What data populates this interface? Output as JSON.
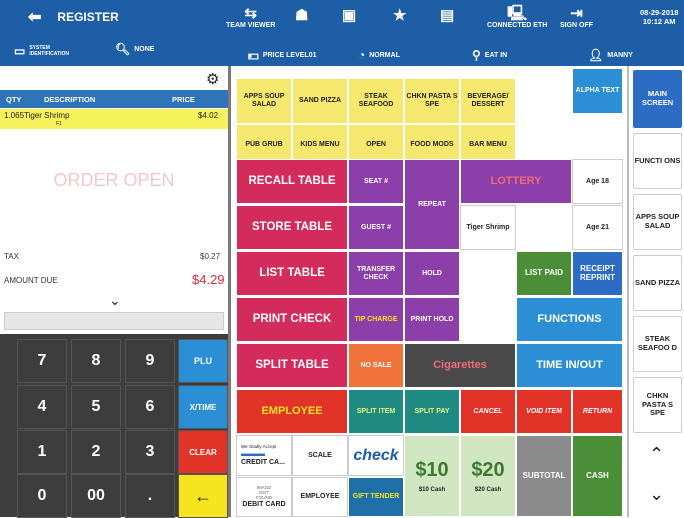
{
  "topbar": {
    "back_icon": "arrow-left-icon",
    "register": "REGISTER",
    "system_id": "SYSTEM IDENTIFICATION",
    "search": "NONE",
    "team_viewer": "TEAM VIEWER",
    "price_level": "PRICE LEVEL01",
    "mode": "NORMAL",
    "connected": "CONNECTED ETH",
    "eat_in": "EAT IN",
    "sign_off": "SIGN OFF",
    "user": "MANNY",
    "date": "08-29-2018",
    "time": "10:12 AM"
  },
  "order": {
    "gear_icon": "gear-icon",
    "headers": {
      "qty": "QTY",
      "desc": "DESCRIPTION",
      "price": "PRICE"
    },
    "items": [
      {
        "qty": "1.065",
        "desc": "Tiger Shrimp",
        "price": "$4.02",
        "sub": "F1"
      }
    ],
    "status": "ORDER OPEN",
    "tax_label": "TAX",
    "tax": "$0.27",
    "due_label": "AMOUNT DUE",
    "due": "$4.29"
  },
  "keypad": {
    "keys": [
      "7",
      "8",
      "9",
      "4",
      "5",
      "6",
      "1",
      "2",
      "3",
      "0",
      "00",
      "."
    ],
    "plu": "PLU",
    "xtime": "X/TIME",
    "clear": "CLEAR",
    "enter": "←"
  },
  "grid": {
    "apps": "APPS SOUP SALAD",
    "sand": "SAND PIZZA",
    "steak": "STEAK SEAFOOD",
    "chkn": "CHKN PASTA S SPE",
    "bev": "BEVERAGE/ DESSERT",
    "alpha": "ALPHA TEXT",
    "pub": "PUB GRUB",
    "kids": "KIDS MENU",
    "open": "OPEN",
    "food": "FOOD MODS",
    "bar": "BAR MENU",
    "recall": "RECALL TABLE",
    "seat": "SEAT #",
    "repeat": "REPEAT",
    "lottery": "LOTTERY",
    "age18": "Age 18",
    "store": "STORE TABLE",
    "guest": "GUEST #",
    "tiger": "Tiger Shrimp",
    "age21": "Age 21",
    "list": "LIST TABLE",
    "transfer": "TRANSFER CHECK",
    "hold": "HOLD",
    "listpaid": "LIST PAID",
    "receipt": "RECEIPT REPRINT",
    "print": "PRINT CHECK",
    "tip": "TIP CHARGE",
    "printhold": "PRINT HOLD",
    "functions": "FUNCTIONS",
    "split": "SPLIT TABLE",
    "nosale": "NO SALE",
    "cig": "Cigarettes",
    "timeio": "TIME IN/OUT",
    "employee": "EMPLOYEE",
    "splititem": "SPLIT ITEM",
    "splitpay": "SPLIT PAY",
    "cancel": "CANCEL",
    "void": "VOID ITEM",
    "return": "RETURN",
    "credit": "CREDIT CA...",
    "credit_note": "We Gladly Accept",
    "scale": "SCALE",
    "check": "check",
    "ten": "$10",
    "ten_cap": "$10 Cash",
    "twenty": "$20",
    "twenty_cap": "$20 Cash",
    "subtotal": "SUBTOTAL",
    "cash": "CASH",
    "debit": "DEBIT CARD",
    "debit_note": "IMAGE NOT FOUND",
    "employee2": "EMPLOYEE",
    "gift": "GIFT TENDER"
  },
  "side": {
    "main": "MAIN SCREEN",
    "func": "FUNCTI ONS",
    "apps": "APPS SOUP SALAD",
    "sand": "SAND PIZZA",
    "steak": "STEAK SEAFOO D",
    "chkn": "CHKN PASTA S SPE",
    "up_icon": "chevron-up-icon",
    "down_icon": "chevron-down-icon"
  }
}
